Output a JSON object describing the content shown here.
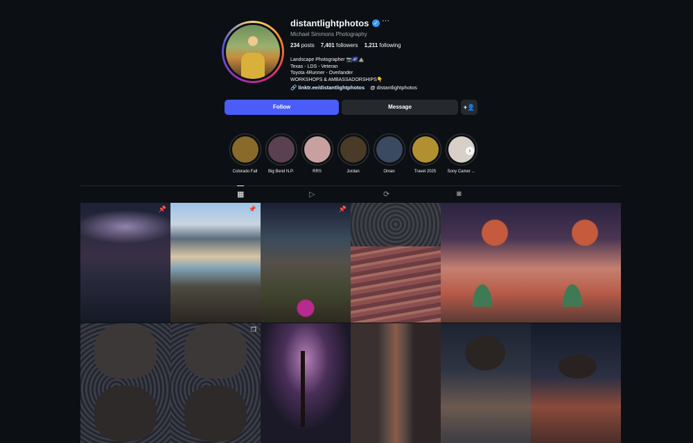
{
  "profile": {
    "username": "distantlightphotos",
    "full_name": "Michael Simmons Photography",
    "posts_count": "234",
    "posts_label": "posts",
    "followers_count": "7,401",
    "followers_label": "followers",
    "following_count": "1,211",
    "following_label": "following",
    "bio_lines": [
      "Landscape Photographer 📷🌌⛰️",
      "Texas - LDS - Veteran",
      "Toyota 4Runner - Overlander",
      "WORKSHOPS & AMBASSADORSHIPS👇"
    ],
    "link_text": "linktr.ee/distantlightphotos",
    "threads_handle": "distantlightphotos"
  },
  "buttons": {
    "follow": "Follow",
    "message": "Message",
    "add_user_icon": "+👤"
  },
  "highlights": [
    {
      "label": "Colorado Fall",
      "color": "#8a6a2a"
    },
    {
      "label": "Big Bend N.P.",
      "color": "#5a4050"
    },
    {
      "label": "RRS",
      "color": "#c8a0a0"
    },
    {
      "label": "Jordan",
      "color": "#4a3a28"
    },
    {
      "label": "Oman",
      "color": "#3a4a60"
    },
    {
      "label": "Travel 2025",
      "color": "#b09030"
    },
    {
      "label": "Sony Camer ...",
      "color": "#d8d0c8"
    }
  ],
  "tabs": [
    "posts-grid-icon",
    "reels-icon",
    "tagged-repost-icon",
    "tagged-icon"
  ],
  "accent": "#4a5df9",
  "grid_pinned": [
    true,
    true,
    true,
    false,
    false,
    false,
    false,
    false,
    false,
    false,
    false,
    false
  ]
}
